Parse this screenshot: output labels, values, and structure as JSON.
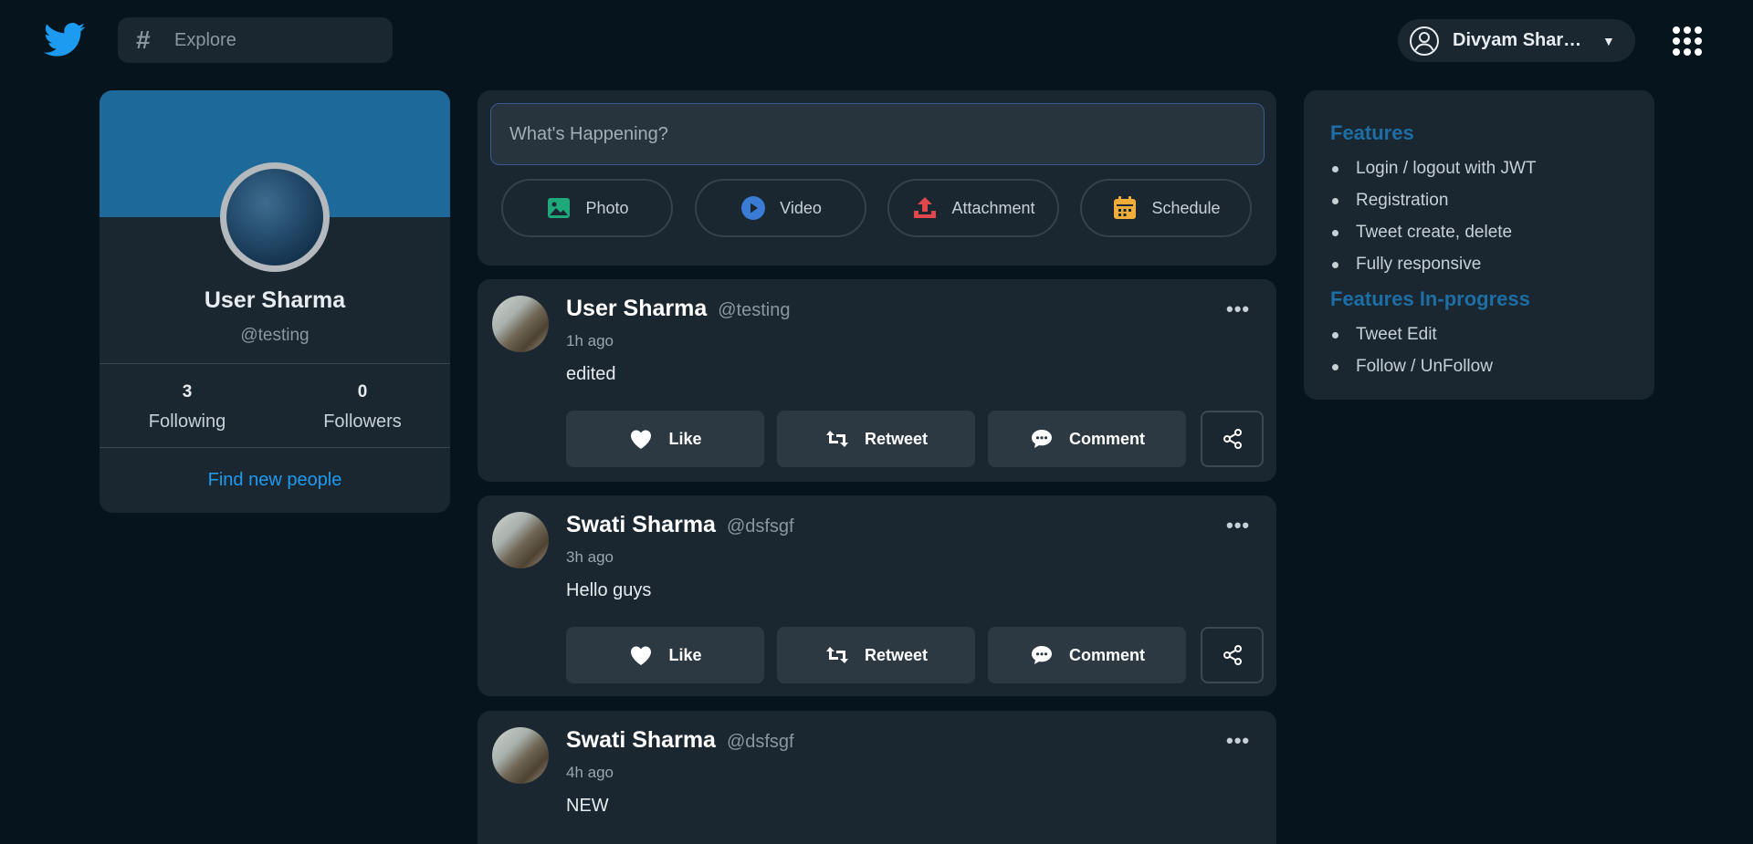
{
  "header": {
    "search_placeholder": "Explore",
    "search_hash": "#",
    "user_name": "Divyam Sharm...",
    "caret": "▼"
  },
  "profile": {
    "name": "User Sharma",
    "handle": "@testing",
    "following_count": "3",
    "following_label": "Following",
    "followers_count": "0",
    "followers_label": "Followers",
    "find_link": "Find new people"
  },
  "composer": {
    "placeholder": "What's Happening?",
    "buttons": [
      {
        "label": "Photo",
        "icon": "photo-icon",
        "color": "#1fa97a"
      },
      {
        "label": "Video",
        "icon": "video-icon",
        "color": "#3a7bd5"
      },
      {
        "label": "Attachment",
        "icon": "upload-icon",
        "color": "#e0474c"
      },
      {
        "label": "Schedule",
        "icon": "calendar-icon",
        "color": "#f0ad3a"
      }
    ]
  },
  "tweets": [
    {
      "name": "User Sharma",
      "handle": "@testing",
      "time": "1h ago",
      "text": "edited"
    },
    {
      "name": "Swati Sharma",
      "handle": "@dsfsgf",
      "time": "3h ago",
      "text": "Hello guys"
    },
    {
      "name": "Swati Sharma",
      "handle": "@dsfsgf",
      "time": "4h ago",
      "text": "NEW"
    }
  ],
  "actions": {
    "like": "Like",
    "retweet": "Retweet",
    "comment": "Comment",
    "more": "•••"
  },
  "features": {
    "title": "Features",
    "items": [
      "Login / logout with JWT",
      "Registration",
      "Tweet create, delete",
      "Fully responsive"
    ],
    "inprogress_title": "Features In-progress",
    "inprogress_items": [
      "Tweet Edit",
      "Follow / UnFollow"
    ]
  },
  "colors": {
    "background": "#06141d",
    "card": "#1b2730",
    "accent": "#1d9bf0",
    "banner": "#1d6a9a"
  }
}
